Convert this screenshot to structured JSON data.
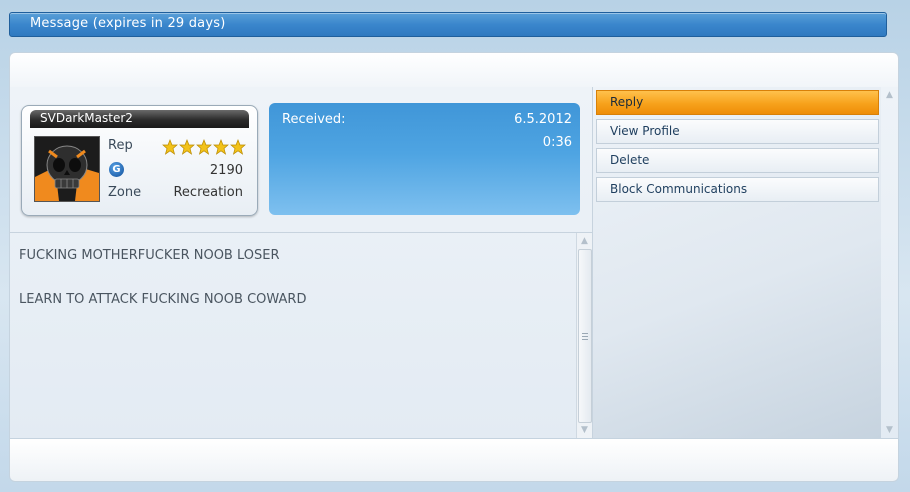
{
  "window": {
    "title": "Message (expires in 29 days)"
  },
  "sender": {
    "username": "SVDarkMaster2",
    "rep_label": "Rep",
    "rep_stars": 5,
    "rep_stars_max": 5,
    "rank_icon": "g-badge-icon",
    "rank_badge_letter": "G",
    "rank_value": "2190",
    "zone_label": "Zone",
    "zone_value": "Recreation",
    "avatar_icon": "skull-avatar-icon"
  },
  "received": {
    "label": "Received:",
    "date": "6.5.2012",
    "time": "0:36"
  },
  "message": {
    "lines": [
      "FUCKING MOTHERFUCKER NOOB LOSER",
      "LEARN TO ATTACK FUCKING NOOB COWARD"
    ]
  },
  "actions": [
    {
      "label": "Reply",
      "primary": true
    },
    {
      "label": "View Profile",
      "primary": false
    },
    {
      "label": "Delete",
      "primary": false
    },
    {
      "label": "Block Communications",
      "primary": false
    }
  ],
  "colors": {
    "accent_blue": "#4096d8",
    "primary_action": "#f7a21b",
    "star": "#f2c21a"
  }
}
